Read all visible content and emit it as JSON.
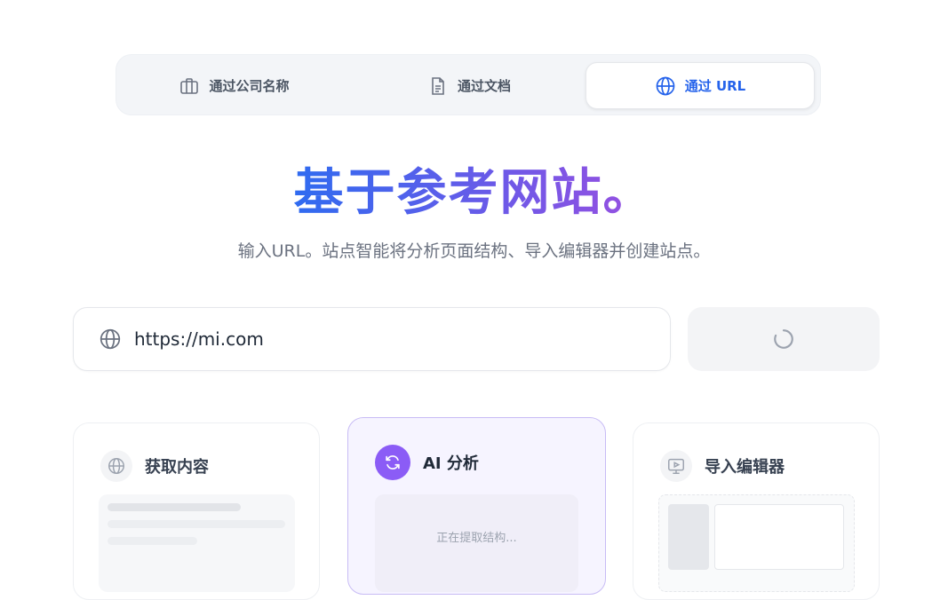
{
  "tabs": [
    {
      "label": "通过公司名称",
      "icon": "briefcase-icon"
    },
    {
      "label": "通过文档",
      "icon": "document-icon"
    },
    {
      "label": "通过 URL",
      "icon": "globe-icon",
      "active": true
    }
  ],
  "hero": {
    "title": "基于参考网站。",
    "subtitle": "输入URL。站点智能将分析页面结构、导入编辑器并创建站点。"
  },
  "url_input": {
    "value": "https://mi.com",
    "icon": "globe-icon"
  },
  "submit": {
    "state": "loading",
    "icon": "spinner-icon"
  },
  "steps": [
    {
      "title": "获取内容",
      "icon": "globe-icon"
    },
    {
      "title": "AI 分析",
      "icon": "refresh-icon",
      "status": "正在提取结构...",
      "active": true
    },
    {
      "title": "导入编辑器",
      "icon": "monitor-play-icon"
    }
  ],
  "colors": {
    "accent": "#2563eb",
    "gradient_start": "#2f6bf0",
    "gradient_end": "#9b4fe0",
    "analysis_purple": "#8b5cf6"
  }
}
